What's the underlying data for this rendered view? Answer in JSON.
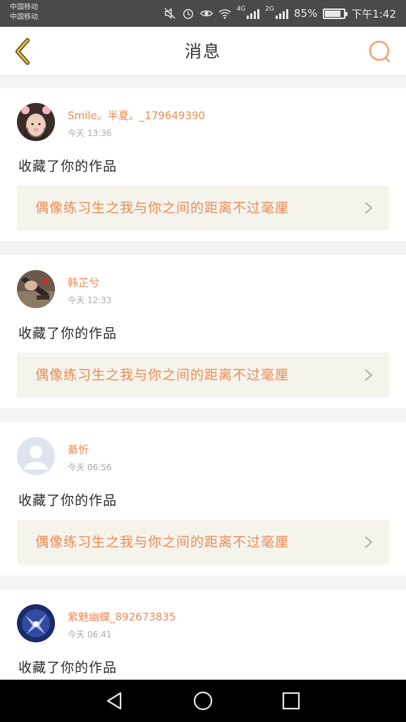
{
  "status_bar": {
    "carrier_1": "中国移动",
    "carrier_2": "中国移动",
    "net_4g": "4G",
    "net_2g": "2G",
    "battery": "85%",
    "battery_level": 0.85,
    "time": "下午1:42"
  },
  "header": {
    "title": "消息",
    "accent_color": "#f0a640",
    "search_color": "#f0a26a"
  },
  "messages": [
    {
      "user": "Smile。半夏。_179649390",
      "time": "今天 13:36",
      "action": "收藏了你的作品",
      "work": "偶像练习生之我与你之间的距离不过毫厘"
    },
    {
      "user": "韩芷兮",
      "time": "今天 12:33",
      "action": "收藏了你的作品",
      "work": "偶像练习生之我与你之间的距离不过毫厘"
    },
    {
      "user": "綦忻",
      "time": "今天 06:56",
      "action": "收藏了你的作品",
      "work": "偶像练习生之我与你之间的距离不过毫厘"
    },
    {
      "user": "紫魅幽蝶_892673835",
      "time": "今天 06:41",
      "action": "收藏了你的作品",
      "work": ""
    }
  ]
}
